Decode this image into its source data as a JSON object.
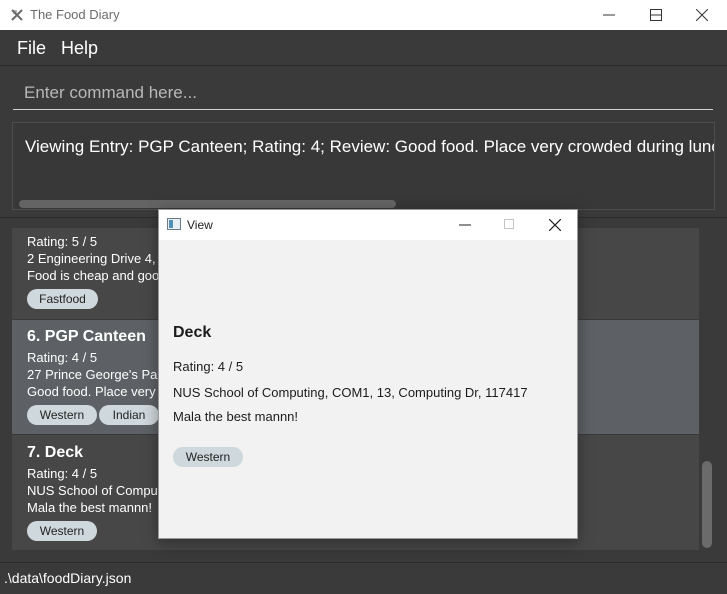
{
  "window": {
    "title": "The Food Diary"
  },
  "menu": {
    "file": "File",
    "help": "Help"
  },
  "command": {
    "placeholder": "Enter command here..."
  },
  "result": {
    "text": "Viewing Entry: PGP Canteen; Rating: 4; Review: Good food. Place very crowded during lunch; A"
  },
  "entries": [
    {
      "title": "",
      "rating": "Rating: 5 / 5",
      "address": "2 Engineering Drive 4, S",
      "review": "Food is cheap and goo",
      "tags": [
        "Fastfood"
      ]
    },
    {
      "title": "6.  PGP Canteen",
      "rating": "Rating: 4 / 5",
      "address": "27 Prince George's Park",
      "review": "Good food. Place very",
      "tags": [
        "Western",
        "Indian"
      ]
    },
    {
      "title": "7.  Deck",
      "rating": "Rating: 4 / 5",
      "address": "NUS School of Comput",
      "review": "Mala the best mannn!",
      "tags": [
        "Western"
      ]
    }
  ],
  "status": {
    "path": ".\\data\\foodDiary.json"
  },
  "popup": {
    "title": "View",
    "name": "Deck",
    "rating": "Rating: 4 / 5",
    "address": "NUS School of Computing, COM1, 13, Computing Dr, 117417",
    "review": "Mala the best mannn!",
    "tag": "Western"
  },
  "colors": {
    "background": "#3a3a3a",
    "selected_card": "#5d6165",
    "card": "#474747",
    "tag": "#cfd8dc"
  }
}
